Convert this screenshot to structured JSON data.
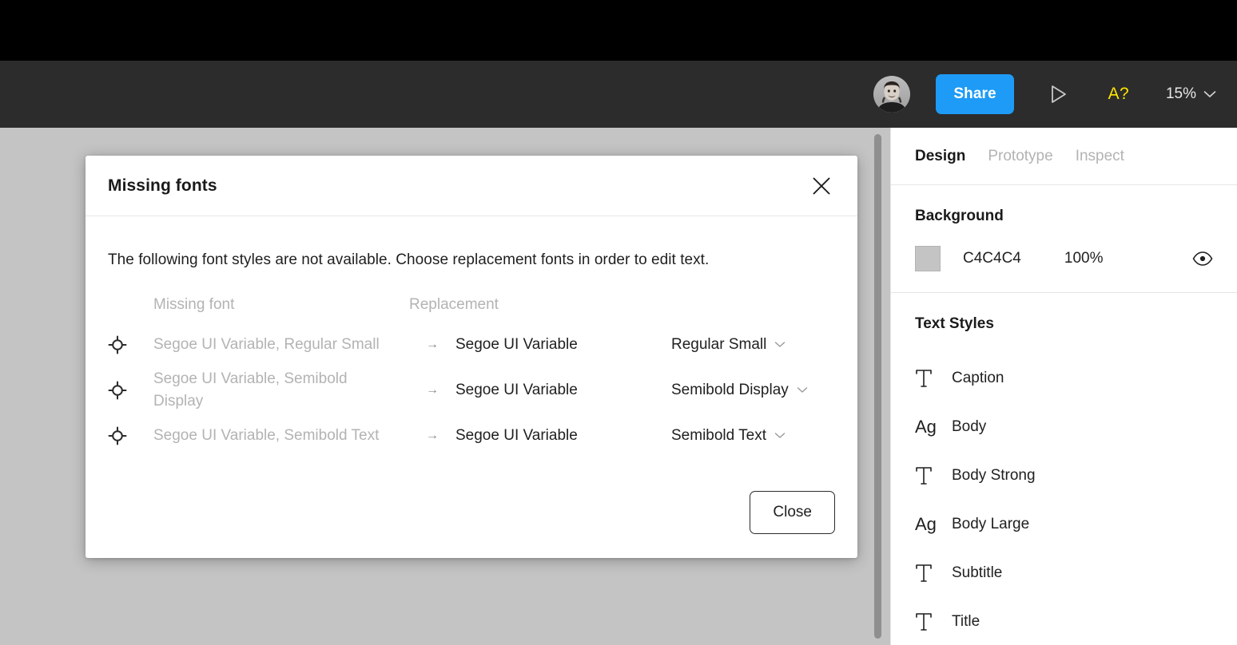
{
  "toolbar": {
    "avatar_name": "user-avatar",
    "share_label": "Share",
    "present_icon": "play-icon",
    "missing_font_icon": "A?",
    "zoom_value": "15%",
    "zoom_caret_icon": "chevron-down-icon",
    "share_color": "#1d9bf6",
    "warning_color": "#ffe500"
  },
  "canvas": {
    "background_color": "#c4c4c4"
  },
  "modal": {
    "title": "Missing fonts",
    "close_icon": "close-icon",
    "description": "The following font styles are not available. Choose replacement fonts in order to edit text.",
    "columns": {
      "missing": "Missing font",
      "replacement": "Replacement"
    },
    "rows": [
      {
        "locate_icon": "target-icon",
        "missing": "Segoe UI Variable, Regular Small",
        "arrow": "→",
        "family": "Segoe UI Variable",
        "style": "Regular Small",
        "caret_icon": "chevron-down-icon"
      },
      {
        "locate_icon": "target-icon",
        "missing": "Segoe UI Variable, Semibold Display",
        "arrow": "→",
        "family": "Segoe UI Variable",
        "style": "Semibold Display",
        "caret_icon": "chevron-down-icon"
      },
      {
        "locate_icon": "target-icon",
        "missing": "Segoe UI Variable, Semibold Text",
        "arrow": "→",
        "family": "Segoe UI Variable",
        "style": "Semibold Text",
        "caret_icon": "chevron-down-icon"
      }
    ],
    "close_button_label": "Close"
  },
  "sidebar": {
    "tabs": [
      {
        "label": "Design",
        "active": true
      },
      {
        "label": "Prototype",
        "active": false
      },
      {
        "label": "Inspect",
        "active": false
      }
    ],
    "background": {
      "heading": "Background",
      "swatch_color": "#c4c4c4",
      "hex": "C4C4C4",
      "opacity": "100%",
      "visibility_icon": "eye-icon"
    },
    "text_styles": {
      "heading": "Text Styles",
      "items": [
        {
          "icon": "text-t-icon",
          "label": "Caption"
        },
        {
          "icon": "text-ag-icon",
          "label": "Body"
        },
        {
          "icon": "text-t-icon",
          "label": "Body Strong"
        },
        {
          "icon": "text-ag-icon",
          "label": "Body Large"
        },
        {
          "icon": "text-t-icon",
          "label": "Subtitle"
        },
        {
          "icon": "text-t-icon",
          "label": "Title"
        }
      ]
    }
  }
}
